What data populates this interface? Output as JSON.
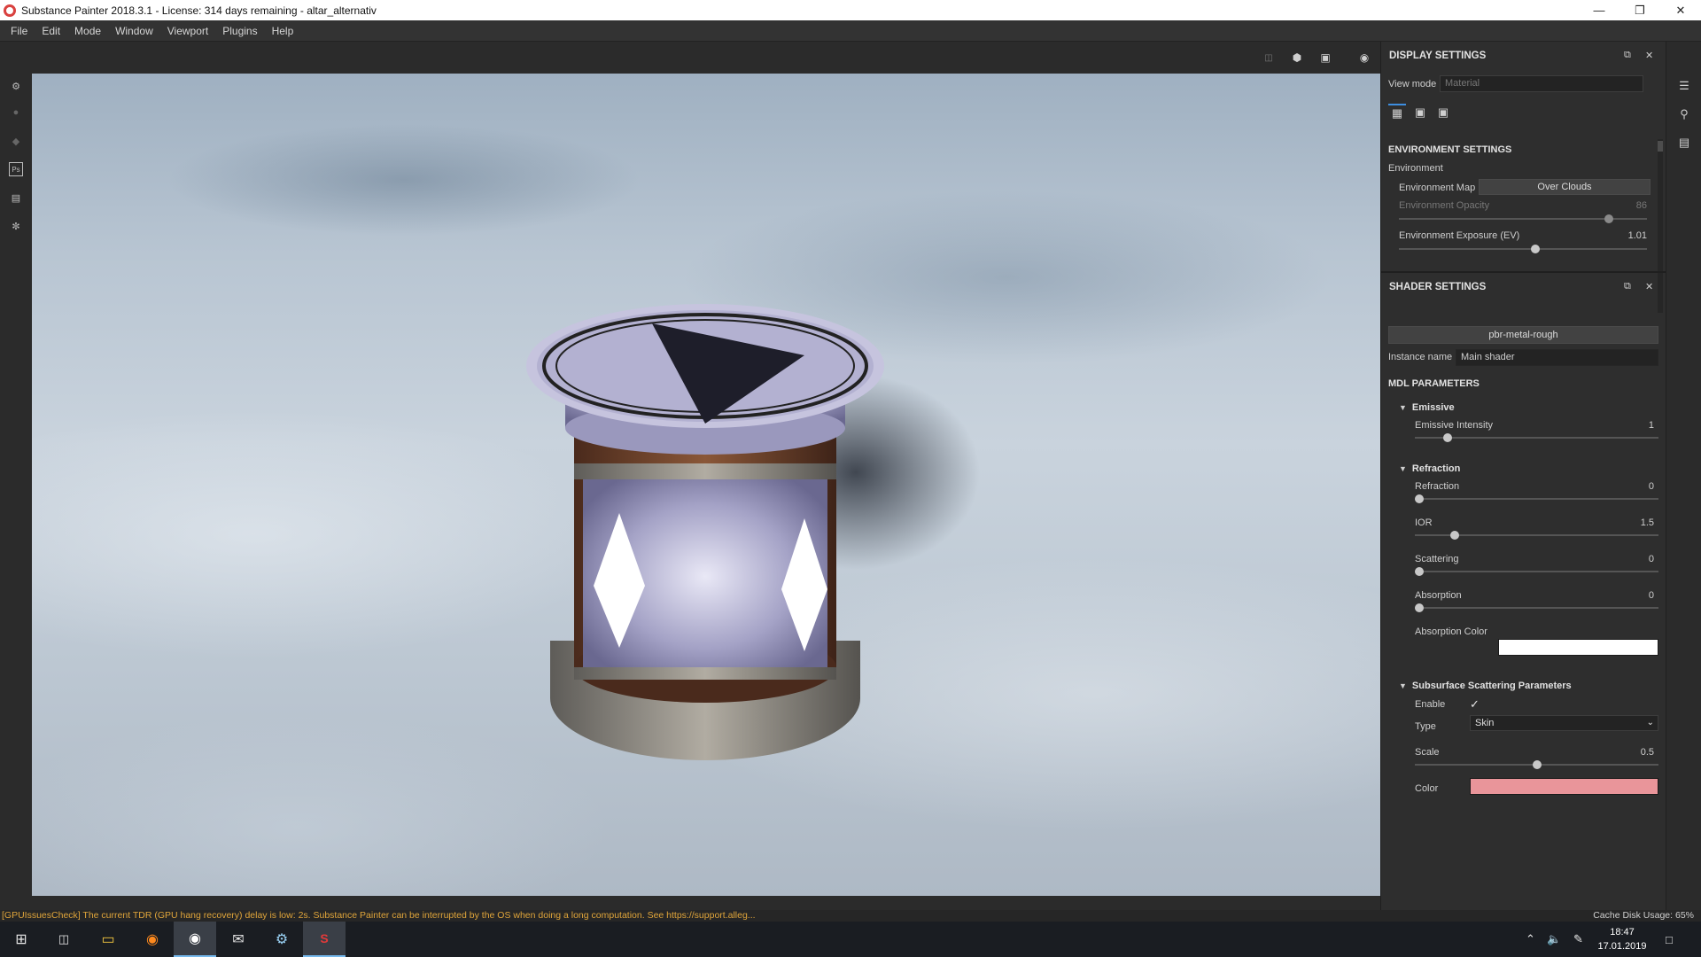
{
  "window": {
    "title": "Substance Painter 2018.3.1 - License: 314 days remaining - altar_alternativ",
    "minimize_icon": "minimize-icon",
    "maximize_icon": "restore-icon",
    "close_icon": "close-icon"
  },
  "menu": {
    "items": [
      "File",
      "Edit",
      "Mode",
      "Window",
      "Viewport",
      "Plugins",
      "Help"
    ]
  },
  "display_settings": {
    "title": "DISPLAY SETTINGS",
    "view_mode_label": "View mode",
    "view_mode_value": "Material",
    "environment_settings_title": "ENVIRONMENT SETTINGS",
    "environment_label": "Environment",
    "environment_map_label": "Environment Map",
    "environment_map_value": "Over Clouds",
    "environment_opacity_label": "Environment Opacity",
    "environment_opacity_value": "86",
    "environment_opacity_fraction": 0.86,
    "environment_exposure_label": "Environment Exposure (EV)",
    "environment_exposure_value": "1.01",
    "environment_exposure_fraction": 0.55
  },
  "shader_settings": {
    "title": "SHADER SETTINGS",
    "shader_name": "pbr-metal-rough",
    "instance_name_label": "Instance name",
    "instance_name_value": "Main shader",
    "mdl_title": "MDL PARAMETERS",
    "emissive": {
      "title": "Emissive",
      "intensity_label": "Emissive Intensity",
      "intensity_value": "1",
      "intensity_fraction": 0.12
    },
    "refraction": {
      "title": "Refraction",
      "refraction_label": "Refraction",
      "refraction_value": "0",
      "refraction_fraction": 0.0,
      "ior_label": "IOR",
      "ior_value": "1.5",
      "ior_fraction": 0.15,
      "scattering_label": "Scattering",
      "scattering_value": "0",
      "scattering_fraction": 0.0,
      "absorption_label": "Absorption",
      "absorption_value": "0",
      "absorption_fraction": 0.0,
      "absorption_color_label": "Absorption Color",
      "absorption_color": "#ffffff"
    },
    "sss": {
      "title": "Subsurface Scattering Parameters",
      "enable_label": "Enable",
      "enable_checked": true,
      "type_label": "Type",
      "type_value": "Skin",
      "scale_label": "Scale",
      "scale_value": "0.5",
      "scale_fraction": 0.5,
      "color_label": "Color",
      "color": "#e9959a"
    }
  },
  "status": {
    "message": "[GPUIssuesCheck] The current TDR (GPU hang recovery) delay is low: 2s. Substance Painter can be interrupted by the OS when doing a long computation. See https://support.alleg...",
    "cache": "Cache Disk Usage:   65%"
  },
  "taskbar": {
    "time": "18:47",
    "date": "17.01.2019"
  },
  "colors": {
    "accent": "#3d8ee0",
    "status_warning": "#e0a53a"
  }
}
